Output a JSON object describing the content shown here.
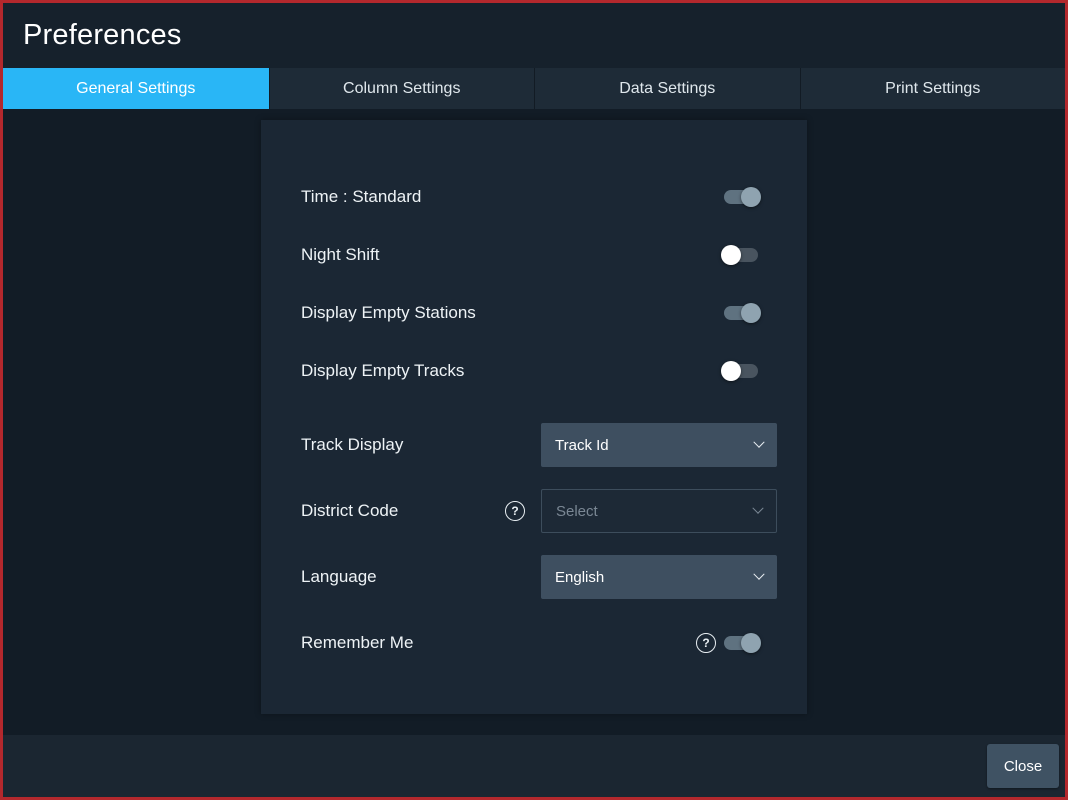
{
  "window": {
    "title": "Preferences"
  },
  "tabs": [
    {
      "label": "General Settings",
      "active": true
    },
    {
      "label": "Column Settings",
      "active": false
    },
    {
      "label": "Data Settings",
      "active": false
    },
    {
      "label": "Print Settings",
      "active": false
    }
  ],
  "settings": {
    "toggles": [
      {
        "label": "Time : Standard",
        "on": true
      },
      {
        "label": "Night Shift",
        "on": false
      },
      {
        "label": "Display Empty Stations",
        "on": true
      },
      {
        "label": "Display Empty Tracks",
        "on": false
      }
    ],
    "dropdowns": [
      {
        "label": "Track Display",
        "value": "Track Id",
        "placeholder": false,
        "help": false
      },
      {
        "label": "District Code",
        "value": "Select",
        "placeholder": true,
        "help": true
      },
      {
        "label": "Language",
        "value": "English",
        "placeholder": false,
        "help": false
      }
    ],
    "remember": {
      "label": "Remember Me",
      "on": true,
      "help": true
    }
  },
  "icons": {
    "help": "?"
  },
  "footer": {
    "close_label": "Close"
  },
  "colors": {
    "border-red": "#b3282d",
    "accent": "#29b6f6",
    "bg": "#121c26",
    "panel": "#1b2734",
    "select-filled": "#3e4f60",
    "btn": "#3f5263"
  }
}
